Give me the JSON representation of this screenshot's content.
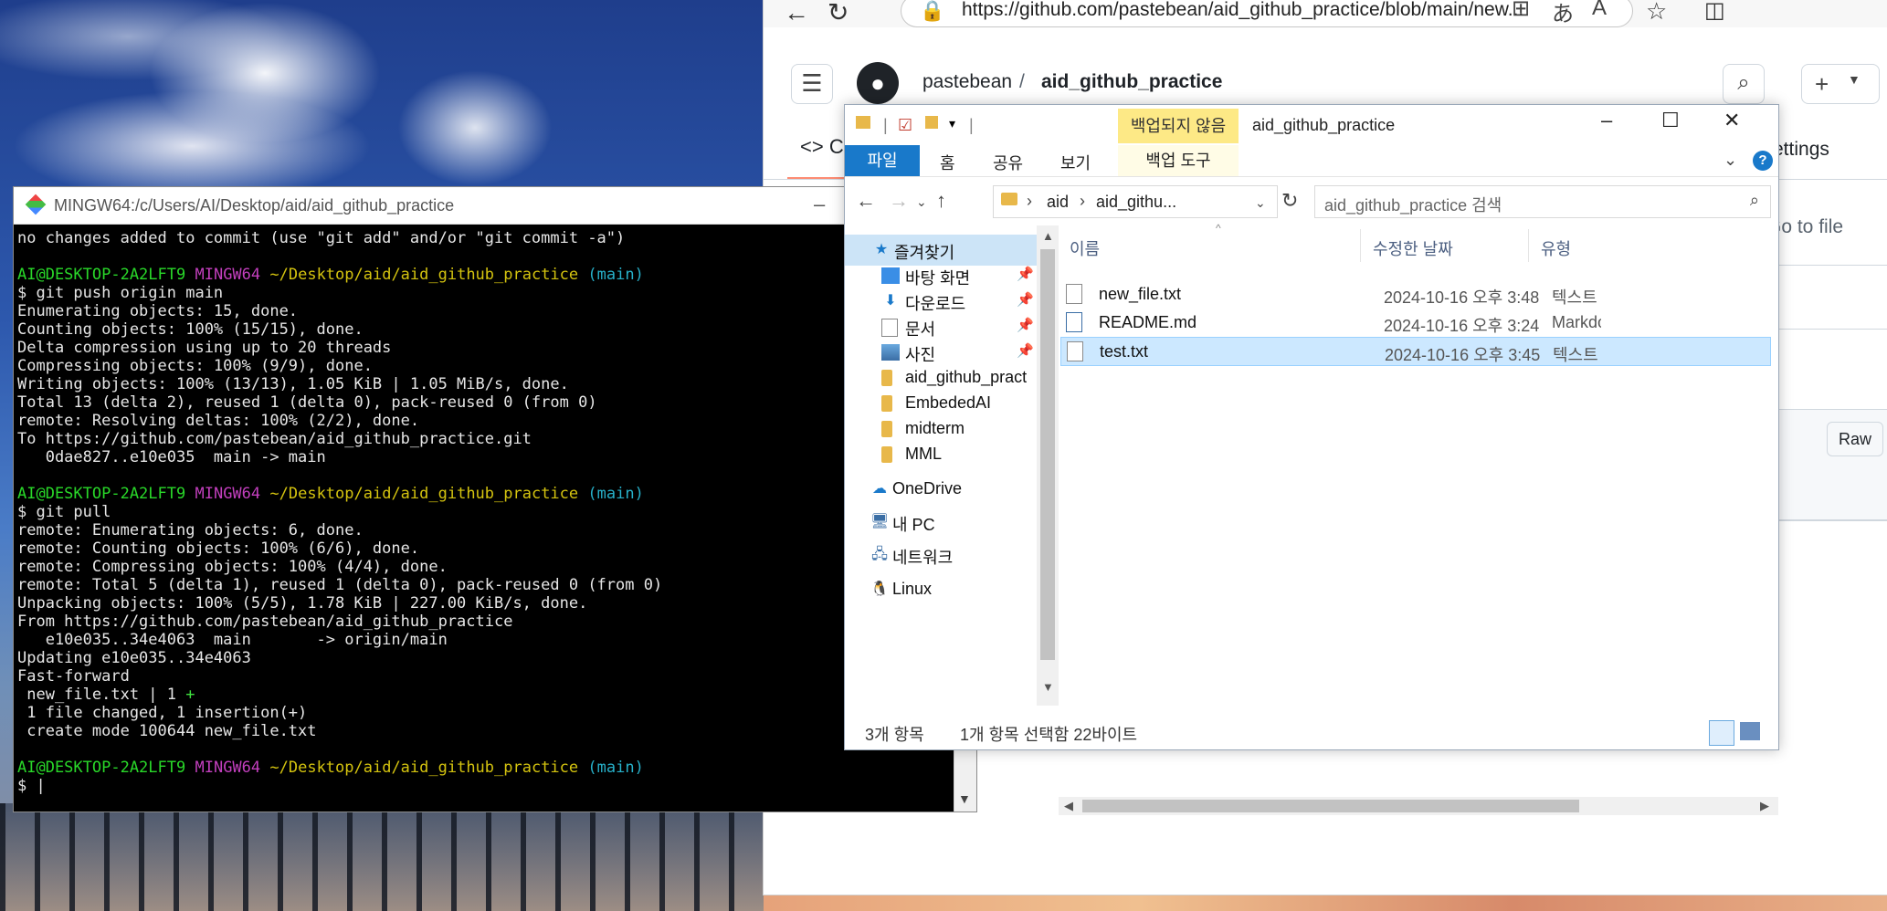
{
  "browser": {
    "url": "https://github.com/pastebean/aid_github_practice/blob/main/new...",
    "repo_owner": "pastebean",
    "separator": "/",
    "repo_name": "aid_github_practice",
    "code_tab_partial": "C",
    "settings_tab_partial": "ettings",
    "go_to_file": "Go to file",
    "raw_button": "Raw"
  },
  "terminal": {
    "title": "MINGW64:/c/Users/AI/Desktop/aid/aid_github_practice",
    "lines": [
      "no changes added to commit (use \"git add\" and/or \"git commit -a\")",
      "",
      "PROMPT",
      "$ git push origin main",
      "Enumerating objects: 15, done.",
      "Counting objects: 100% (15/15), done.",
      "Delta compression using up to 20 threads",
      "Compressing objects: 100% (9/9), done.",
      "Writing objects: 100% (13/13), 1.05 KiB | 1.05 MiB/s, done.",
      "Total 13 (delta 2), reused 1 (delta 0), pack-reused 0 (from 0)",
      "remote: Resolving deltas: 100% (2/2), done.",
      "To https://github.com/pastebean/aid_github_practice.git",
      "   0dae827..e10e035  main -> main",
      "",
      "PROMPT",
      "$ git pull",
      "remote: Enumerating objects: 6, done.",
      "remote: Counting objects: 100% (6/6), done.",
      "remote: Compressing objects: 100% (4/4), done.",
      "remote: Total 5 (delta 1), reused 1 (delta 0), pack-reused 0 (from 0)",
      "Unpacking objects: 100% (5/5), 1.78 KiB | 227.00 KiB/s, done.",
      "From https://github.com/pastebean/aid_github_practice",
      "   e10e035..34e4063  main       -> origin/main",
      "Updating e10e035..34e4063",
      "Fast-forward",
      "DIFFSTAT",
      " 1 file changed, 1 insertion(+)",
      " create mode 100644 new_file.txt",
      "",
      "PROMPT",
      "$ |"
    ],
    "prompt": {
      "user": "AI@DESKTOP-2A2LFT9",
      "shell": "MINGW64",
      "path": "~/Desktop/aid/aid_github_practice",
      "branch": "(main)"
    },
    "diffstat": {
      "text": " new_file.txt | 1 ",
      "plus": "+"
    }
  },
  "explorer": {
    "title": "aid_github_practice",
    "context_label": "백업되지 않음",
    "ribbon": {
      "file": "파일",
      "home": "홈",
      "share": "공유",
      "view": "보기",
      "backup_tools": "백업 도구"
    },
    "address": {
      "root": "aid",
      "current": "aid_githu..."
    },
    "search_placeholder": "aid_github_practice 검색",
    "nav": {
      "quick_access": "즐겨찾기",
      "desktop": "바탕 화면",
      "downloads": "다운로드",
      "documents": "문서",
      "pictures": "사진",
      "folder1": "aid_github_pract",
      "folder2": "EmbededAI",
      "folder3": "midterm",
      "folder4": "MML",
      "onedrive": "OneDrive",
      "this_pc": "내 PC",
      "network": "네트워크",
      "linux": "Linux"
    },
    "columns": {
      "name": "이름",
      "modified": "수정한 날짜",
      "type": "유형"
    },
    "files": [
      {
        "name": "new_file.txt",
        "modified": "2024-10-16 오후 3:48",
        "type": "텍스트 문"
      },
      {
        "name": "README.md",
        "modified": "2024-10-16 오후 3:24",
        "type": "Markdow"
      },
      {
        "name": "test.txt",
        "modified": "2024-10-16 오후 3:45",
        "type": "텍스트 문"
      }
    ],
    "status": {
      "count": "3개 항목",
      "selected": "1개 항목 선택함 22바이트"
    }
  }
}
